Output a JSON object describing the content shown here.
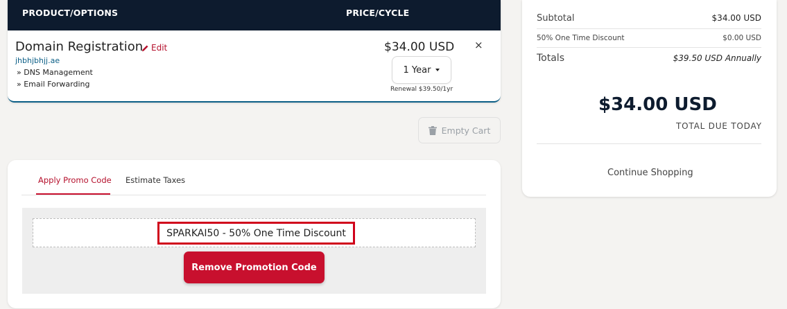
{
  "cart": {
    "header": {
      "product": "PRODUCT/OPTIONS",
      "price": "PRICE/CYCLE"
    },
    "item": {
      "name": "Domain Registration",
      "edit_label": "Edit",
      "domain": "jhbhjbhjj.ae",
      "options": [
        "» DNS Management",
        "» Email Forwarding"
      ],
      "price": "$34.00 USD",
      "cycle": "1 Year",
      "renewal": "Renewal $39.50/1yr",
      "remove_symbol": "×"
    },
    "empty_cart_label": "Empty Cart"
  },
  "promo": {
    "tabs": [
      "Apply Promo Code",
      "Estimate Taxes"
    ],
    "active_tab": "Apply Promo Code",
    "applied_code": "SPARKAI50 - 50% One Time Discount",
    "remove_button": "Remove Promotion Code"
  },
  "summary": {
    "subtotal_label": "Subtotal",
    "subtotal_value": "$34.00 USD",
    "discount_label": "50% One Time Discount",
    "discount_value": "$0.00 USD",
    "totals_label": "Totals",
    "totals_value": "$39.50 USD Annually",
    "total_due_amount": "$34.00 USD",
    "total_due_label": "TOTAL DUE TODAY",
    "continue_label": "Continue Shopping"
  },
  "colors": {
    "header_bg": "#0d1b2e",
    "accent_red": "#c8102e",
    "link_blue": "#0b5e86",
    "highlight_box": "#d0021b"
  },
  "icons": {
    "edit": "pencil-icon",
    "empty_cart": "trash-icon",
    "cycle_dropdown": "caret-down-icon"
  }
}
